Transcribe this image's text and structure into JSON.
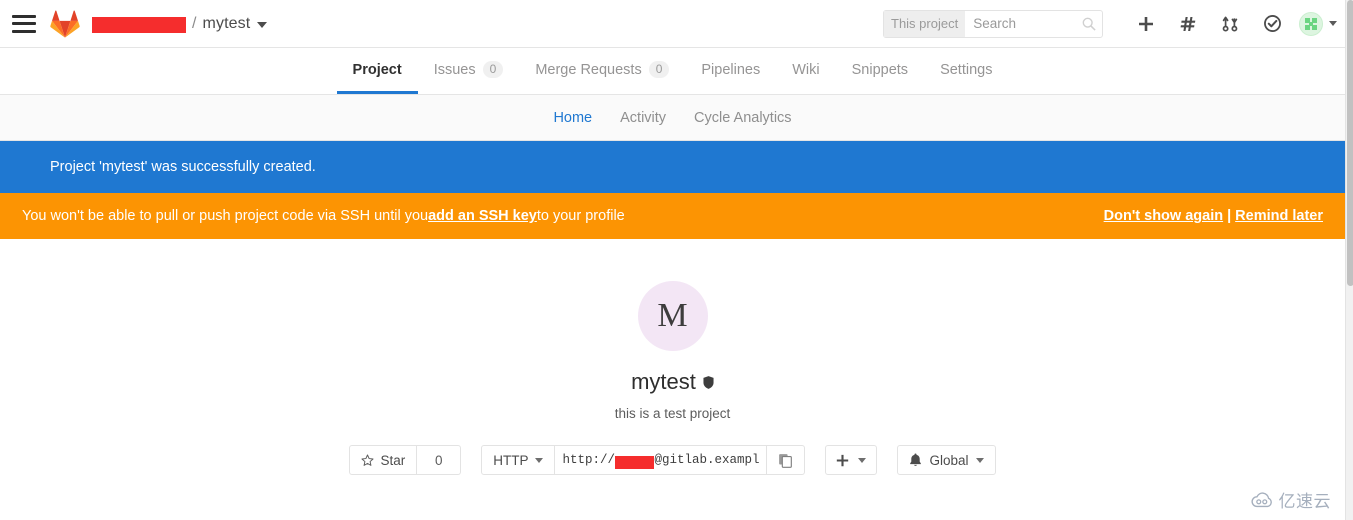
{
  "navbar": {
    "menu_icon": "hamburger-icon",
    "logo_icon": "gitlab-tanuki-logo",
    "breadcrumb": {
      "namespace_redacted": "",
      "separator": "/",
      "project": "mytest"
    },
    "search": {
      "scope_label": "This project",
      "placeholder": "Search",
      "value": "",
      "icon": "search-icon"
    },
    "actions": [
      {
        "name": "new-dropdown",
        "icon": "plus-icon"
      },
      {
        "name": "issues-link",
        "icon": "hash-icon"
      },
      {
        "name": "merge-requests-link",
        "icon": "merge-request-icon"
      },
      {
        "name": "todos-link",
        "icon": "check-circle-icon"
      }
    ],
    "avatar": {
      "name": "user-avatar",
      "icon": "identicon"
    }
  },
  "tabs": [
    {
      "label": "Project",
      "badge": null,
      "active": true
    },
    {
      "label": "Issues",
      "badge": "0",
      "active": false
    },
    {
      "label": "Merge Requests",
      "badge": "0",
      "active": false
    },
    {
      "label": "Pipelines",
      "badge": null,
      "active": false
    },
    {
      "label": "Wiki",
      "badge": null,
      "active": false
    },
    {
      "label": "Snippets",
      "badge": null,
      "active": false
    },
    {
      "label": "Settings",
      "badge": null,
      "active": false
    }
  ],
  "subnav": [
    {
      "label": "Home",
      "active": true
    },
    {
      "label": "Activity",
      "active": false
    },
    {
      "label": "Cycle Analytics",
      "active": false
    }
  ],
  "flash_info": {
    "message": "Project 'mytest' was successfully created.",
    "color": "#1f78d1"
  },
  "flash_warning": {
    "text_before": "You won't be able to pull or push project code via SSH until you ",
    "link": "add an SSH key",
    "text_after": " to your profile",
    "dismiss_label": "Don't show again",
    "separator": "|",
    "remind_label": "Remind later",
    "color": "#fc9403"
  },
  "project": {
    "avatar_letter": "M",
    "avatar_bg": "#f3e6f5",
    "title": "mytest",
    "visibility_icon": "shield-icon",
    "description": "this is a test project",
    "star_label": "Star",
    "star_icon": "star-icon",
    "star_count": "0",
    "clone_protocol": "HTTP",
    "clone_url_prefix": "http://",
    "clone_url_suffix": "@gitlab.exampl",
    "copy_icon": "copy-icon",
    "plus_icon": "plus-icon",
    "notification_icon": "bell-icon",
    "notification_level": "Global"
  },
  "watermark": {
    "text": "亿速云",
    "icon": "cloud-icon"
  }
}
